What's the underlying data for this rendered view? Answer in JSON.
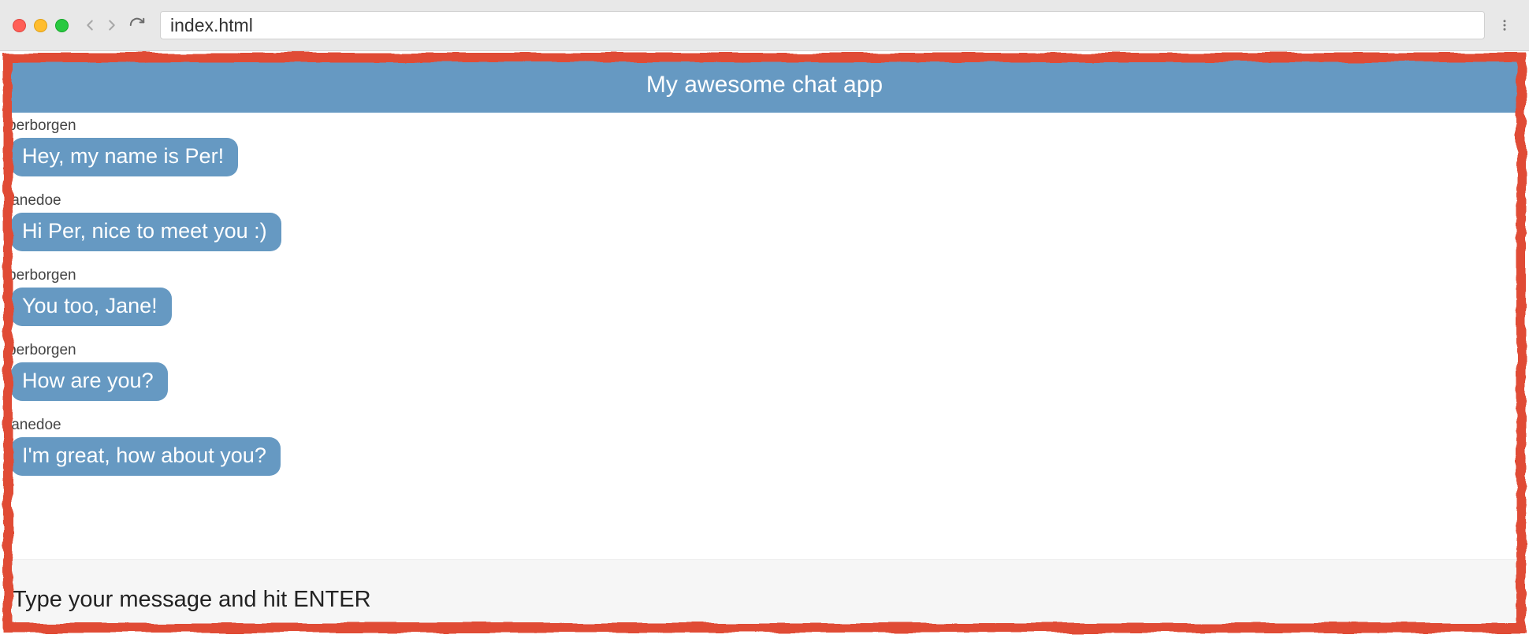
{
  "browser": {
    "url": "index.html"
  },
  "app": {
    "title": "My awesome chat app"
  },
  "messages": [
    {
      "user": "perborgen",
      "text": "Hey, my name is Per!"
    },
    {
      "user": "janedoe",
      "text": "Hi Per, nice to meet you :)"
    },
    {
      "user": "perborgen",
      "text": "You too, Jane!"
    },
    {
      "user": "perborgen",
      "text": "How are you?"
    },
    {
      "user": "janedoe",
      "text": "I'm great, how about you?"
    }
  ],
  "input": {
    "placeholder": "Type your message and hit ENTER"
  },
  "colors": {
    "accent": "#6699c2",
    "crayon": "#e04b34"
  }
}
